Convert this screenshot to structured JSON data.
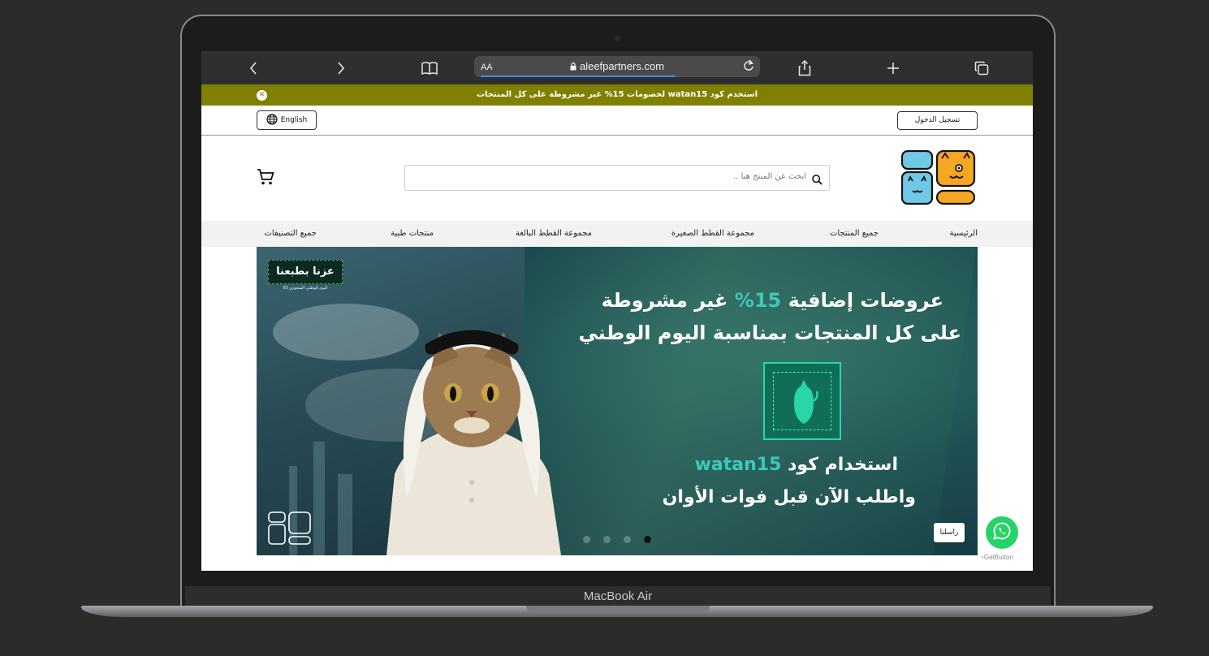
{
  "device": {
    "label": "MacBook Air"
  },
  "browser": {
    "url_prefix": "AA",
    "url": "aleefpartners.com",
    "icons": [
      "back-icon",
      "forward-icon",
      "book-icon",
      "share-icon",
      "plus-icon",
      "tabs-icon",
      "lock-icon",
      "reload-icon"
    ]
  },
  "promo": {
    "text": "استخدم كود watan15 لخصومات 15% غير مشروطة على كل المنتجات",
    "color": "#808000"
  },
  "utility": {
    "language_label": "English",
    "login_label": "تسجيل الدخول"
  },
  "header": {
    "search_placeholder": "ابحث عن المنتج هنا .."
  },
  "nav": {
    "items": [
      {
        "label": "الرئيسية"
      },
      {
        "label": "جميع المنتجات"
      },
      {
        "label": "مجموعة القطط الصغيرة"
      },
      {
        "label": "مجموعة القطط البالغة"
      },
      {
        "label": "منتجات طبية"
      },
      {
        "label": "جميع التصنيفات"
      }
    ]
  },
  "hero": {
    "badge_title": "عزنا بطبعنا",
    "badge_subtitle": "اليوم الوطني السعودي 93",
    "line1_a": "عروضات إضافية ",
    "line1_b": "15%",
    "line1_c": " غير مشروطة",
    "line2": "على كل المنتجات بمناسبة اليوم الوطني",
    "line3_a": "استخدام كود ",
    "line3_b": "watan15",
    "line4": "واطلب الآن قبل فوات الأوان",
    "slides": 4,
    "active_slide": 4,
    "accent_color": "#3cc9b8"
  },
  "whatsapp": {
    "label": "راسلنا",
    "credit": "GetButton"
  }
}
